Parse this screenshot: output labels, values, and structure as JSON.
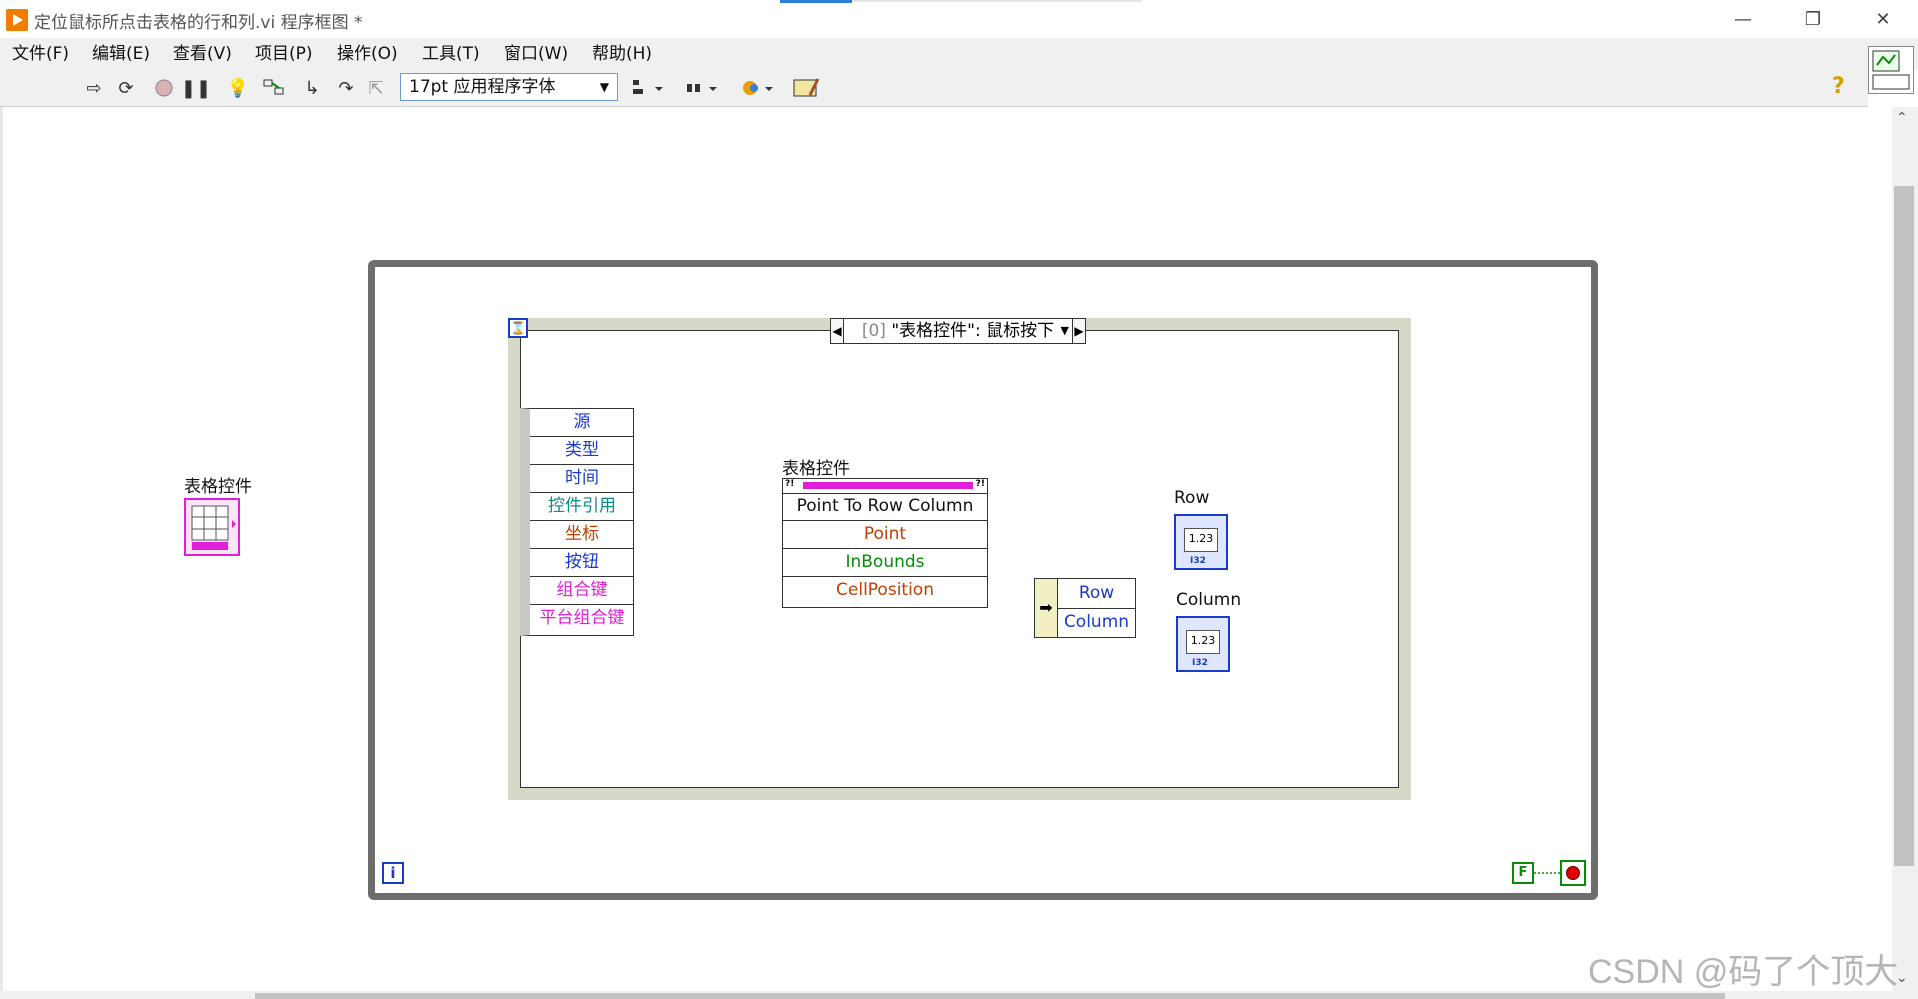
{
  "window": {
    "title": "定位鼠标所点击表格的行和列.vi 程序框图 *",
    "minimize_glyph": "—",
    "restore_glyph": "❐",
    "close_glyph": "✕"
  },
  "menu": [
    "文件(F)",
    "编辑(E)",
    "查看(V)",
    "项目(P)",
    "操作(O)",
    "工具(T)",
    "窗口(W)",
    "帮助(H)"
  ],
  "toolbar": {
    "font_select": "17pt 应用程序字体",
    "font_arrow": "▼",
    "help": "?",
    "icons": [
      "run-arrow-icon",
      "run-continuously-icon",
      "abort-icon",
      "pause-icon",
      "highlight-execution-icon",
      "retain-wire-values-icon",
      "step-into-icon",
      "step-over-icon",
      "step-out-icon",
      "align-objects-icon",
      "distribute-objects-icon",
      "reorder-icon",
      "clean-up-diagram-icon"
    ]
  },
  "diagram": {
    "while_loop": {
      "iteration_terminal": "i",
      "false_constant": "F"
    },
    "event_structure": {
      "timeout_glyph": "⌛",
      "case_label": "[0] \"表格控件\": 鼠标按下",
      "case_index": "[0]",
      "case_event": "\"表格控件\": 鼠标按下",
      "left_arrow": "◀",
      "right_arrow": "▶",
      "dropdown": "▼"
    },
    "event_data_node": [
      {
        "label": "源",
        "color": "#1a3ac8"
      },
      {
        "label": "类型",
        "color": "#1a3ac8"
      },
      {
        "label": "时间",
        "color": "#1a3ac8"
      },
      {
        "label": "控件引用",
        "color": "#0a8a8a"
      },
      {
        "label": "坐标",
        "color": "#c04000"
      },
      {
        "label": "按钮",
        "color": "#1a3ac8"
      },
      {
        "label": "组合键",
        "color": "#e020d8"
      },
      {
        "label": "平台组合键",
        "color": "#e020d8"
      }
    ],
    "invoke_node": {
      "label": "表格控件",
      "method": "Point To Row Column",
      "params": [
        {
          "label": "Point",
          "color": "#c04000"
        },
        {
          "label": "InBounds",
          "color": "#0a8a0a"
        },
        {
          "label": "CellPosition",
          "color": "#c04000"
        }
      ]
    },
    "unbundle": {
      "arrow": "➡",
      "outputs": [
        "Row",
        "Column"
      ]
    },
    "indicators": [
      {
        "label": "Row",
        "display": "1.23",
        "type": "I32"
      },
      {
        "label": "Column",
        "display": "1.23",
        "type": "I32"
      }
    ],
    "table_control": {
      "label": "表格控件"
    }
  },
  "watermark": "CSDN @码了个顶大",
  "colors": {
    "cluster_wire": "#a0522d",
    "i32_wire": "#1a3ac8",
    "while_border": "#6d6d6d",
    "ref_wire": "#0a8a0a"
  }
}
